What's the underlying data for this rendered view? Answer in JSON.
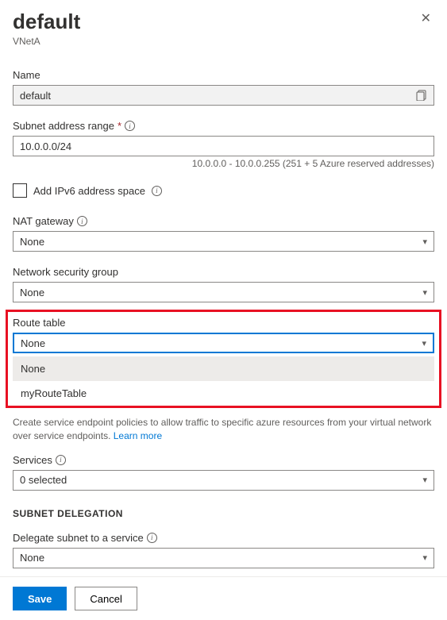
{
  "header": {
    "title": "default",
    "subtitle": "VNetA"
  },
  "name": {
    "label": "Name",
    "value": "default"
  },
  "subnetRange": {
    "label": "Subnet address range",
    "value": "10.0.0.0/24",
    "hint": "10.0.0.0 - 10.0.0.255 (251 + 5 Azure reserved addresses)"
  },
  "ipv6": {
    "label": "Add IPv6 address space"
  },
  "natGateway": {
    "label": "NAT gateway",
    "value": "None"
  },
  "nsg": {
    "label": "Network security group",
    "value": "None"
  },
  "routeTable": {
    "label": "Route table",
    "value": "None",
    "options": [
      "None",
      "myRouteTable"
    ]
  },
  "serviceEndpointsHelp": {
    "text": "Create service endpoint policies to allow traffic to specific azure resources from your virtual network over service endpoints.",
    "link": "Learn more"
  },
  "services": {
    "label": "Services",
    "value": "0 selected"
  },
  "delegation": {
    "heading": "SUBNET DELEGATION",
    "label": "Delegate subnet to a service",
    "value": "None"
  },
  "footer": {
    "save": "Save",
    "cancel": "Cancel"
  }
}
